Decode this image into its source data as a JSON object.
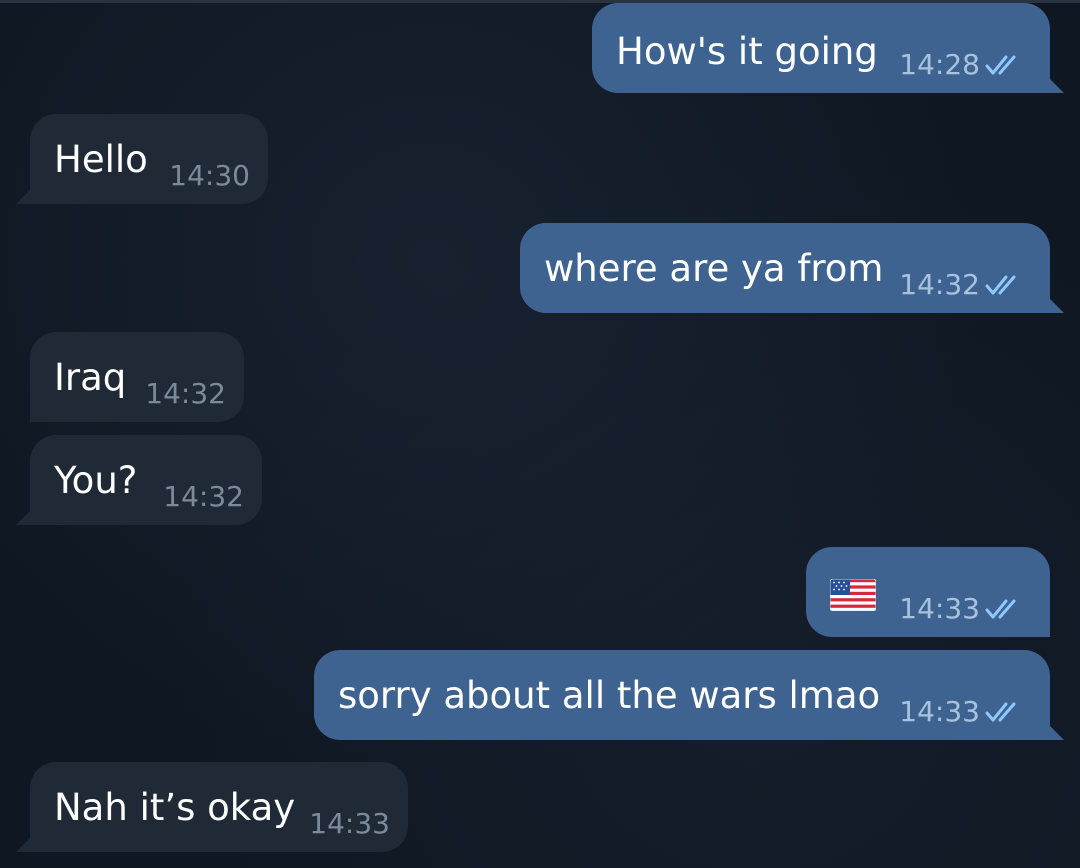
{
  "chat": {
    "messages": [
      {
        "direction": "out",
        "text": "How's it going",
        "time": "14:28",
        "status": "read-double-check-icon"
      },
      {
        "direction": "in",
        "text": "Hello",
        "time": "14:30"
      },
      {
        "direction": "out",
        "text": "where are ya from",
        "time": "14:32",
        "status": "read-double-check-icon"
      },
      {
        "direction": "in",
        "text": "Iraq",
        "time": "14:32"
      },
      {
        "direction": "in",
        "text": "You?",
        "time": "14:32"
      },
      {
        "direction": "out",
        "text": "",
        "emoji": "us-flag-icon",
        "time": "14:33",
        "status": "read-double-check-icon"
      },
      {
        "direction": "out",
        "text": "sorry about all the wars lmao",
        "time": "14:33",
        "status": "read-double-check-icon"
      },
      {
        "direction": "in",
        "text": "Nah it’s okay",
        "time": "14:33"
      }
    ]
  },
  "colors": {
    "background": "#0f1722",
    "outgoing_bubble": "#3e6391",
    "incoming_bubble": "#1f2a36",
    "outgoing_time": "#a9c3de",
    "incoming_time": "#7c8b9b",
    "check_mark": "#8fc7ff"
  }
}
